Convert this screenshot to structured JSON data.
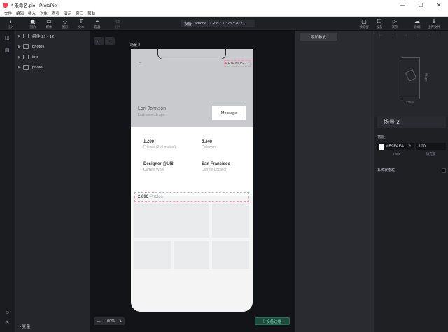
{
  "window": {
    "title": "* 未命名.pie - ProtoPie",
    "controls": [
      "—",
      "☐",
      "✕"
    ]
  },
  "menu": [
    "文件",
    "编辑",
    "插入",
    "对象",
    "查看",
    "演示",
    "窗口",
    "帮助"
  ],
  "toolbar": {
    "left": [
      {
        "icon": "⭳",
        "label": "导入"
      },
      {
        "icon": "▣",
        "label": "图片"
      },
      {
        "icon": "▭",
        "label": "媒体"
      },
      {
        "icon": "◇",
        "label": "图形"
      },
      {
        "icon": "T",
        "label": "文本"
      },
      {
        "icon": "⌖",
        "label": "容器"
      },
      {
        "icon": "⧉",
        "label": "组件"
      }
    ],
    "device_label": "设备",
    "device_value": "iPhone 11 Pro / X 375 x 812 ...",
    "right": [
      {
        "icon": "▢",
        "label": "预览窗"
      },
      {
        "icon": "☐",
        "label": "设备"
      },
      {
        "icon": "▷",
        "label": "演示"
      },
      {
        "icon": "☁",
        "label": "云端"
      },
      {
        "icon": "⇪",
        "label": "上传文件"
      }
    ]
  },
  "layers": [
    {
      "name": "组件 21 - 12"
    },
    {
      "name": "photos"
    },
    {
      "name": "info"
    },
    {
      "name": "photo"
    }
  ],
  "layers_footer": "变量",
  "canvas": {
    "scene_label": "场景 2",
    "back": "←",
    "forward": "→",
    "zoom": "100%",
    "zoom_minus": "—",
    "zoom_plus": "+",
    "device_frame_button": "设备边框"
  },
  "profile": {
    "back_icon": "←",
    "friends_link": "FRIENDS",
    "name": "Lori Johnson",
    "last_seen": "Last seen 1h ago",
    "message_button": "Message",
    "stats": [
      {
        "value": "1,200",
        "label": "Friends (210 mutual)"
      },
      {
        "value": "5,340",
        "label": "Followers"
      },
      {
        "value": "Designer @UI8",
        "label": "Current Work"
      },
      {
        "value": "San Francisco",
        "label": "Current Location"
      }
    ],
    "photos_count": "2,890",
    "photos_label": "Photos"
  },
  "interaction_panel": {
    "add_trigger": "添加触发"
  },
  "inspector": {
    "preview_width": "375px",
    "preview_height": "812px",
    "scene_name": "场景 2",
    "background_title": "背景",
    "hex": "#F9FAFA",
    "opacity": "100",
    "hex_caption": "HEX",
    "opacity_caption": "填充度",
    "status_bar_label": "系统状态栏"
  }
}
